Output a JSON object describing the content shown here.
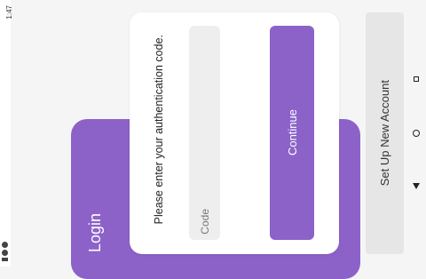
{
  "status_bar": {
    "time": "1:47"
  },
  "login": {
    "title": "Login"
  },
  "auth_dialog": {
    "prompt": "Please enter your authentication code.",
    "code_placeholder": "Code",
    "continue_label": "Continue"
  },
  "setup_button_label": "Set Up New Account",
  "colors": {
    "accent": "#8c62c9",
    "background": "#f5f5f5",
    "field": "#eeeeee",
    "secondary_button": "#e6e6e6"
  },
  "icons": [
    "recents-icon",
    "home-icon",
    "back-icon"
  ]
}
